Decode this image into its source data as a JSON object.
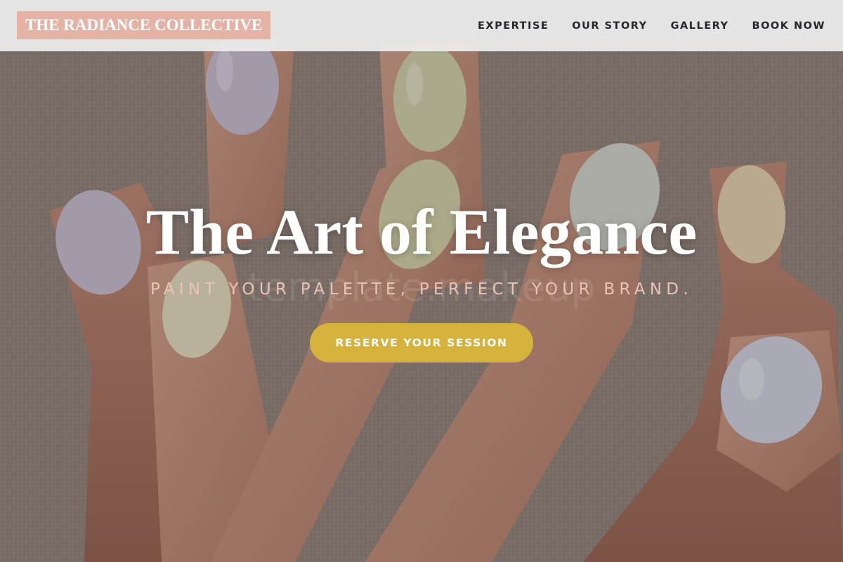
{
  "brand": {
    "name": "THE RADIANCE COLLECTIVE"
  },
  "nav": {
    "items": [
      "EXPERTISE",
      "OUR STORY",
      "GALLERY",
      "BOOK NOW"
    ]
  },
  "hero": {
    "image": "hand-with-pastel-manicure-photo",
    "headline": "The Art of Elegance",
    "subheadline": "PAINT YOUR PALETTE, PERFECT YOUR BRAND.",
    "watermark": "template.makeup",
    "cta_label": "RESERVE YOUR SESSION"
  },
  "colors": {
    "logo_bg": "#e5b3a6",
    "nav_bg": "#ececec",
    "nav_text": "#26262b",
    "subheadline": "#e9c3b8",
    "cta_bg": "#d5b23c",
    "nail_lilac": "#bdb5c9",
    "nail_sage": "#c7c8a4",
    "nail_blue_gray": "#c7cad8"
  }
}
